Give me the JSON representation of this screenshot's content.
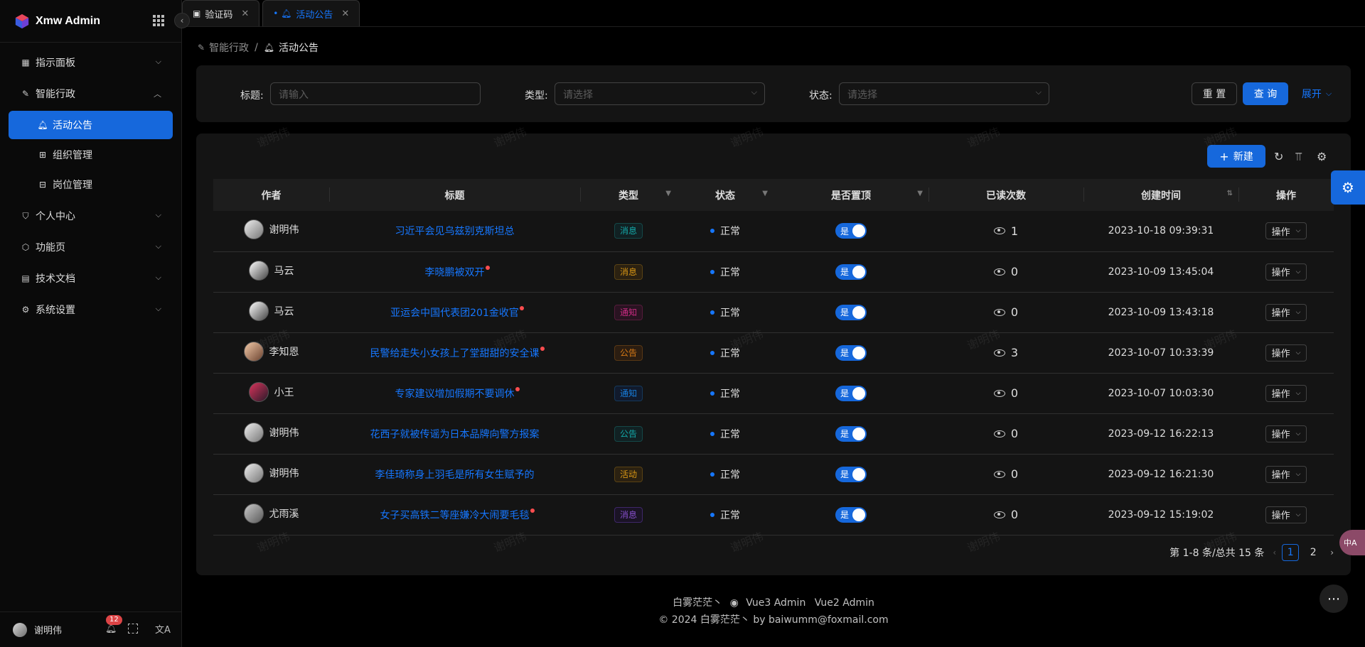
{
  "app": {
    "title": "Xmw Admin"
  },
  "sidebar": {
    "menu": [
      {
        "label": "指示面板",
        "icon": "dashboard-icon",
        "expanded": false
      },
      {
        "label": "智能行政",
        "icon": "leaf-icon",
        "expanded": true,
        "children": [
          {
            "label": "活动公告",
            "icon": "bell-icon",
            "active": true
          },
          {
            "label": "组织管理",
            "icon": "org-icon",
            "active": false
          },
          {
            "label": "岗位管理",
            "icon": "job-icon",
            "active": false
          }
        ]
      },
      {
        "label": "个人中心",
        "icon": "user-shield-icon",
        "expanded": false
      },
      {
        "label": "功能页",
        "icon": "box-icon",
        "expanded": false
      },
      {
        "label": "技术文档",
        "icon": "doc-icon",
        "expanded": false
      },
      {
        "label": "系统设置",
        "icon": "settings-icon",
        "expanded": false
      }
    ],
    "footer": {
      "user": "谢明伟",
      "notifications": "12"
    }
  },
  "tabs": [
    {
      "label": "验证码",
      "active": false
    },
    {
      "label": "活动公告",
      "active": true
    }
  ],
  "breadcrumb": {
    "parent": "智能行政",
    "current": "活动公告"
  },
  "search": {
    "title_label": "标题:",
    "title_placeholder": "请输入",
    "type_label": "类型:",
    "type_placeholder": "请选择",
    "status_label": "状态:",
    "status_placeholder": "请选择",
    "reset": "重 置",
    "query": "查 询",
    "expand": "展开"
  },
  "toolbar": {
    "new": "新建"
  },
  "table": {
    "columns": [
      "作者",
      "标题",
      "类型",
      "状态",
      "是否置顶",
      "已读次数",
      "创建时间",
      "操作"
    ],
    "rows": [
      {
        "author": "谢明伟",
        "title": "习近平会见乌兹别克斯坦总",
        "unread": false,
        "type": "消息",
        "tag": "msg",
        "status": "正常",
        "pinned": "是",
        "reads": "1",
        "created": "2023-10-18 09:39:31",
        "op": "操作"
      },
      {
        "author": "马云",
        "title": "李晓鹏被双开",
        "unread": true,
        "type": "消息",
        "tag": "msg2",
        "status": "正常",
        "pinned": "是",
        "reads": "0",
        "created": "2023-10-09 13:45:04",
        "op": "操作"
      },
      {
        "author": "马云",
        "title": "亚运会中国代表团201金收官",
        "unread": true,
        "type": "通知",
        "tag": "notice",
        "status": "正常",
        "pinned": "是",
        "reads": "0",
        "created": "2023-10-09 13:43:18",
        "op": "操作"
      },
      {
        "author": "李知恩",
        "title": "民警给走失小女孩上了堂甜甜的安全课",
        "unread": true,
        "type": "公告",
        "tag": "gonggao",
        "status": "正常",
        "pinned": "是",
        "reads": "3",
        "created": "2023-10-07 10:33:39",
        "op": "操作"
      },
      {
        "author": "小王",
        "title": "专家建议增加假期不要调休",
        "unread": true,
        "type": "通知",
        "tag": "notice2",
        "status": "正常",
        "pinned": "是",
        "reads": "0",
        "created": "2023-10-07 10:03:30",
        "op": "操作"
      },
      {
        "author": "谢明伟",
        "title": "花西子就被传谣为日本品牌向警方报案",
        "unread": false,
        "type": "公告",
        "tag": "gonggao2",
        "status": "正常",
        "pinned": "是",
        "reads": "0",
        "created": "2023-09-12 16:22:13",
        "op": "操作"
      },
      {
        "author": "谢明伟",
        "title": "李佳琦称身上羽毛是所有女生赋予的",
        "unread": false,
        "type": "活动",
        "tag": "activity",
        "status": "正常",
        "pinned": "是",
        "reads": "0",
        "created": "2023-09-12 16:21:30",
        "op": "操作"
      },
      {
        "author": "尤雨溪",
        "title": "女子买高铁二等座嫌冷大闹要毛毯",
        "unread": true,
        "type": "消息",
        "tag": "msg3",
        "status": "正常",
        "pinned": "是",
        "reads": "0",
        "created": "2023-09-12 15:19:02",
        "op": "操作"
      }
    ]
  },
  "pagination": {
    "summary": "第 1-8 条/总共 15 条",
    "pages": [
      "1",
      "2"
    ],
    "current": "1"
  },
  "footer": {
    "line1_author": "白雾茫茫丶",
    "line1_links": [
      "Vue3 Admin",
      "Vue2 Admin"
    ],
    "line2": "© 2024 白雾茫茫丶  by baiwumm@foxmail.com"
  },
  "watermark": "谢明伟",
  "lang_fab": "中A",
  "colors": {
    "primary": "#1668dc",
    "bg": "#000000",
    "card": "#141414"
  }
}
